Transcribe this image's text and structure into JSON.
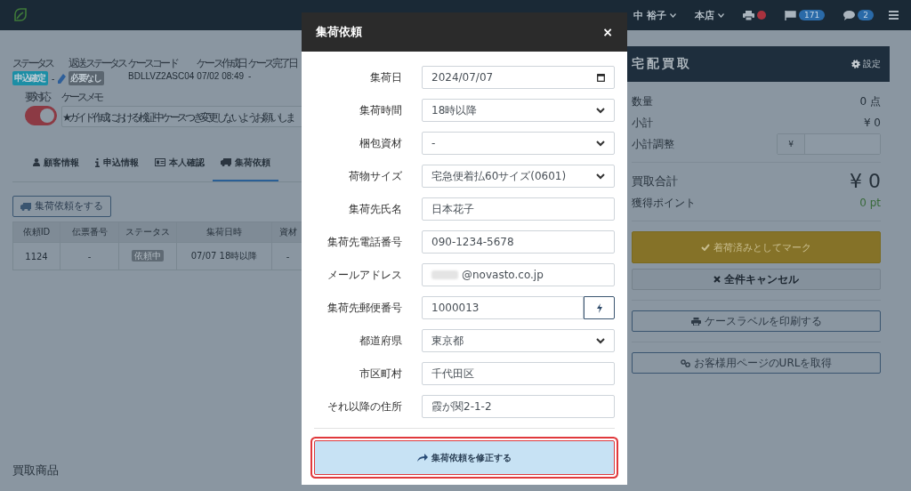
{
  "topbar": {
    "user": "中 裕子",
    "store": "本店",
    "printer_alert": true,
    "flag_count": "171",
    "message_count": "2"
  },
  "case": {
    "fields": [
      {
        "label": "ステータス",
        "kind": "badge",
        "value": "申込確定",
        "color": "#1c8ea5",
        "suffix": "-",
        "editable": true
      },
      {
        "label": "返送ステータス",
        "kind": "badge",
        "value": "必要なし",
        "color": "#5b6670"
      },
      {
        "label": "ケースコード",
        "kind": "text",
        "value": "BDLLVZ2ASC04"
      },
      {
        "label": "ケース作成日",
        "kind": "text",
        "value": "07/02 08:49"
      },
      {
        "label": "ケース完了日",
        "kind": "text",
        "value": "-"
      }
    ],
    "toggle": {
      "label": "要対応",
      "on": true
    },
    "memo": {
      "label": "ケースメモ",
      "value": "★ガイド作成における検証中ケースつき変更しないようお願いしま"
    }
  },
  "tabs": [
    {
      "label": "顧客情報",
      "selected": false
    },
    {
      "label": "申込情報",
      "selected": false
    },
    {
      "label": "本人確認",
      "selected": false
    },
    {
      "label": "集荷依頼",
      "selected": true
    }
  ],
  "pickup": {
    "button": "集荷依頼をする",
    "columns": [
      "依頼ID",
      "伝票番号",
      "ステータス",
      "集荷日時",
      "資材"
    ],
    "rows": [
      [
        {
          "kind": "text",
          "value": "1124"
        },
        {
          "kind": "text",
          "value": "-"
        },
        {
          "kind": "badge",
          "value": "依頼中"
        },
        {
          "kind": "text",
          "value": "07/07 18時以降"
        },
        {
          "kind": "text",
          "value": "-"
        }
      ]
    ]
  },
  "section_heading": "買取商品",
  "panel": {
    "title": "宅配買取",
    "settings": "設定",
    "summary": [
      {
        "label": "数量",
        "value": "0 点"
      },
      {
        "label": "小計",
        "value": "¥ 0"
      }
    ],
    "adjust": {
      "label": "小計調整",
      "prefix": "¥"
    },
    "total": {
      "label": "買取合計",
      "value": "¥ 0"
    },
    "points": {
      "label": "獲得ポイント",
      "value": "0 pt"
    },
    "actions": [
      {
        "label": "着荷済みとしてマーク",
        "kind": "warning"
      },
      {
        "label": "全件キャンセル",
        "kind": "secondary"
      },
      {
        "label": "ケースラベルを印刷する",
        "kind": "outline"
      },
      {
        "label": "お客様用ページのURLを取得",
        "kind": "outline"
      }
    ]
  },
  "modal": {
    "title": "集荷依頼",
    "close": "×",
    "rows": [
      {
        "label": "集荷日",
        "kind": "date",
        "value": "2024/07/07"
      },
      {
        "label": "集荷時間",
        "kind": "select",
        "value": "18時以降"
      },
      {
        "label": "梱包資材",
        "kind": "select",
        "value": "-"
      },
      {
        "label": "荷物サイズ",
        "kind": "select",
        "value": "宅急便着払60サイズ(0601)"
      },
      {
        "label": "集荷先氏名",
        "kind": "text",
        "value": "日本花子"
      },
      {
        "label": "集荷先電話番号",
        "kind": "text",
        "value": "090-1234-5678"
      },
      {
        "label": "メールアドレス",
        "kind": "text",
        "value": "@novasto.co.jp",
        "redacted_prefix": true
      },
      {
        "label": "集荷先郵便番号",
        "kind": "postal",
        "value": "1000013"
      },
      {
        "label": "都道府県",
        "kind": "select",
        "value": "東京都"
      },
      {
        "label": "市区町村",
        "kind": "text",
        "value": "千代田区"
      },
      {
        "label": "それ以降の住所",
        "kind": "text",
        "value": "霞が関2-1-2"
      }
    ],
    "submit": {
      "label": "集荷依頼を修正する",
      "highlighted": true
    }
  }
}
